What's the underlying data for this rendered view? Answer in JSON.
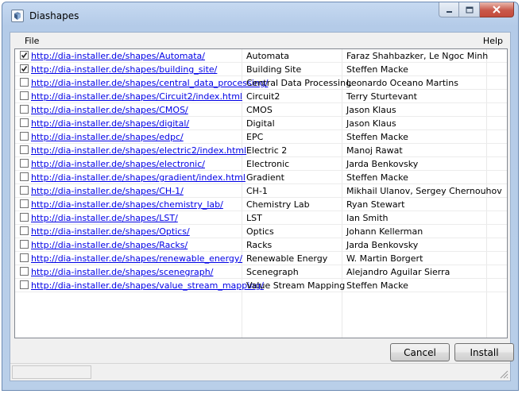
{
  "window": {
    "title": "Diashapes"
  },
  "menu": {
    "file": "File",
    "help": "Help"
  },
  "shapes": [
    {
      "checked": true,
      "url": "http://dia-installer.de/shapes/Automata/",
      "name": "Automata",
      "author": "Faraz Shahbazker, Le Ngoc Minh"
    },
    {
      "checked": true,
      "url": "http://dia-installer.de/shapes/building_site/",
      "name": "Building Site",
      "author": "Steffen Macke"
    },
    {
      "checked": false,
      "url": "http://dia-installer.de/shapes/central_data_processing/",
      "name": "Central Data Processing",
      "author": "Leonardo Oceano Martins"
    },
    {
      "checked": false,
      "url": "http://dia-installer.de/shapes/Circuit2/index.html",
      "name": "Circuit2",
      "author": "Terry Sturtevant"
    },
    {
      "checked": false,
      "url": "http://dia-installer.de/shapes/CMOS/",
      "name": "CMOS",
      "author": "Jason Klaus"
    },
    {
      "checked": false,
      "url": "http://dia-installer.de/shapes/digital/",
      "name": "Digital",
      "author": "Jason Klaus"
    },
    {
      "checked": false,
      "url": "http://dia-installer.de/shapes/edpc/",
      "name": "EPC",
      "author": "Steffen Macke"
    },
    {
      "checked": false,
      "url": "http://dia-installer.de/shapes/electric2/index.html",
      "name": "Electric 2",
      "author": "Manoj Rawat"
    },
    {
      "checked": false,
      "url": "http://dia-installer.de/shapes/electronic/",
      "name": "Electronic",
      "author": "Jarda Benkovsky"
    },
    {
      "checked": false,
      "url": "http://dia-installer.de/shapes/gradient/index.html",
      "name": "Gradient",
      "author": "Steffen Macke"
    },
    {
      "checked": false,
      "url": "http://dia-installer.de/shapes/CH-1/",
      "name": "CH-1",
      "author": "Mikhail Ulanov, Sergey Chernouhov"
    },
    {
      "checked": false,
      "url": "http://dia-installer.de/shapes/chemistry_lab/",
      "name": "Chemistry Lab",
      "author": "Ryan Stewart"
    },
    {
      "checked": false,
      "url": "http://dia-installer.de/shapes/LST/",
      "name": "LST",
      "author": "Ian Smith"
    },
    {
      "checked": false,
      "url": "http://dia-installer.de/shapes/Optics/",
      "name": "Optics",
      "author": "Johann Kellerman"
    },
    {
      "checked": false,
      "url": "http://dia-installer.de/shapes/Racks/",
      "name": "Racks",
      "author": "Jarda Benkovsky"
    },
    {
      "checked": false,
      "url": "http://dia-installer.de/shapes/renewable_energy/",
      "name": "Renewable Energy",
      "author": "W. Martin Borgert"
    },
    {
      "checked": false,
      "url": "http://dia-installer.de/shapes/scenegraph/",
      "name": "Scenegraph",
      "author": "Alejandro Aguilar Sierra"
    },
    {
      "checked": false,
      "url": "http://dia-installer.de/shapes/value_stream_mapping/",
      "name": "Value Stream Mapping",
      "author": "Steffen Macke"
    }
  ],
  "buttons": {
    "cancel": "Cancel",
    "install": "Install"
  },
  "colors": {
    "link": "#0000e6",
    "title_bar": "#c6d9f1",
    "close_button": "#c9584a"
  }
}
